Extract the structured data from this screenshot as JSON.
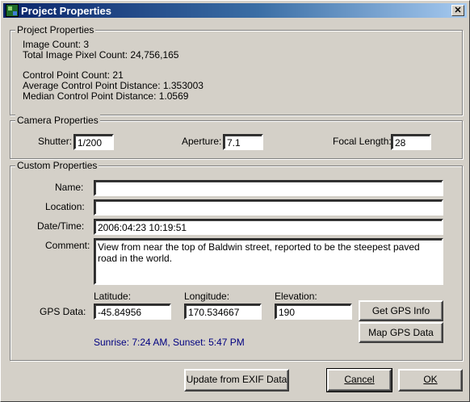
{
  "window": {
    "title": "Project Properties",
    "close_glyph": "✕"
  },
  "project": {
    "group_label": "Project Properties",
    "image_count": "Image Count: 3",
    "pixel_count": "Total Image Pixel Count: 24,756,165",
    "cp_count": "Control Point Count: 21",
    "avg_cp": "Average Control Point Distance: 1.353003",
    "median_cp": "Median Control Point Distance: 1.0569"
  },
  "camera": {
    "group_label": "Camera Properties",
    "shutter_label": "Shutter:",
    "shutter_value": "1/200",
    "aperture_label": "Aperture:",
    "aperture_value": "7.1",
    "focal_label": "Focal Length:",
    "focal_value": "28"
  },
  "custom": {
    "group_label": "Custom Properties",
    "name_label": "Name:",
    "name_value": "",
    "location_label": "Location:",
    "location_value": "",
    "datetime_label": "Date/Time:",
    "datetime_value": "2006:04:23 10:19:51",
    "comment_label": "Comment:",
    "comment_value": "View from near the top of Baldwin street, reported to be the steepest paved road in the world.",
    "gps_label": "GPS Data:",
    "latitude_label": "Latitude:",
    "latitude_value": "-45.84956",
    "longitude_label": "Longitude:",
    "longitude_value": "170.534667",
    "elevation_label": "Elevation:",
    "elevation_value": "190",
    "get_gps_button": "Get GPS Info",
    "map_gps_button": "Map GPS Data",
    "sunrise_sunset": "Sunrise: 7:24 AM,   Sunset: 5:47 PM",
    "sun_color": "#000080"
  },
  "footer": {
    "update_button": "Update from EXIF Data",
    "cancel_button": "Cancel",
    "ok_button": "OK"
  },
  "colors": {
    "titlebar_start": "#0a246a",
    "titlebar_end": "#a6caf0",
    "face": "#d4d0c8"
  }
}
